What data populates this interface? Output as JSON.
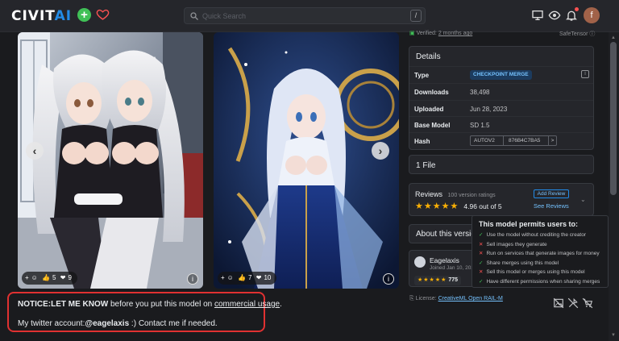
{
  "header": {
    "logo_left": "CIVIT",
    "logo_right": "AI",
    "search_placeholder": "Quick Search",
    "search_shortcut": "/",
    "avatar_letter": "f"
  },
  "cards": [
    {
      "reactions": {
        "add": "+",
        "likes": "5",
        "hearts": "9"
      },
      "info": "i"
    },
    {
      "reactions": {
        "add": "+",
        "likes": "7",
        "hearts": "10"
      },
      "info": "i"
    }
  ],
  "notice": {
    "bold1": "NOTICE:LET ME KNOW",
    "text1": " before you put this model on ",
    "link1": "commercial usage",
    "text1b": ".",
    "text2": "My twitter account:",
    "bold2": "@eagelaxis",
    "text2b": " :) Contact me if needed."
  },
  "sidebar": {
    "verified_label": "Verified: ",
    "verified_link": "2 months ago",
    "safetensor": "SafeTensor",
    "details": {
      "title": "Details",
      "rows": [
        {
          "key": "Type",
          "value": "CHECKPOINT MERGE"
        },
        {
          "key": "Downloads",
          "value": "38,498"
        },
        {
          "key": "Uploaded",
          "value": "Jun 28, 2023"
        },
        {
          "key": "Base Model",
          "value": "SD 1.5"
        },
        {
          "key": "Hash",
          "type": "AUTOV2",
          "value": "876B4C7BA5",
          "copy": ">"
        }
      ]
    },
    "files": "1 File",
    "reviews": {
      "title": "Reviews",
      "count": "100 version ratings",
      "stars": "★★★★★",
      "rating": "4.96 out of 5",
      "add": "Add Review",
      "see": "See Reviews"
    },
    "about": "About this version",
    "author": {
      "name": "Eagelaxis",
      "joined": "Joined Jan 10, 202",
      "stars": "★★★★★",
      "count": "775"
    },
    "license_label": "License: ",
    "license_link": "CreativeML Open RAIL-M"
  },
  "permissions": {
    "title": "This model permits users to:",
    "items": [
      {
        "allowed": true,
        "mark": "✓",
        "text": "Use the model without crediting the creator"
      },
      {
        "allowed": false,
        "mark": "✕",
        "text": "Sell images they generate"
      },
      {
        "allowed": false,
        "mark": "✕",
        "text": "Run on services that generate images for money"
      },
      {
        "allowed": true,
        "mark": "✓",
        "text": "Share merges using this model"
      },
      {
        "allowed": false,
        "mark": "✕",
        "text": "Sell this model or merges using this model"
      },
      {
        "allowed": true,
        "mark": "✓",
        "text": "Have different permissions when sharing merges"
      }
    ]
  },
  "colors": {
    "accent": "#228be6",
    "green": "#40c057",
    "red": "#fa5252",
    "star": "#fab005",
    "notice_border": "#e03131"
  }
}
